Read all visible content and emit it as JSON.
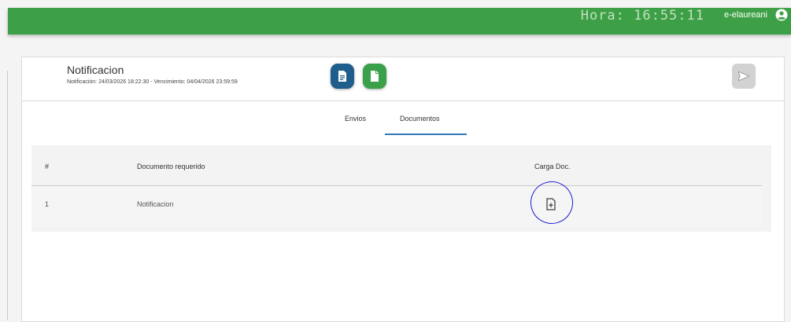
{
  "topbar": {
    "clock": "Hora: 16:55:11",
    "user": "e-elaureani",
    "user_icon": "user-circle-icon",
    "color": "#3ea046"
  },
  "header": {
    "title": "Notificacion",
    "subtitle": "Notificación: 24/03/2026 18:22:30 - Vencimiento: 04/04/2026 23:59:59",
    "doc_button_icon": "file-text-icon",
    "file_button_icon": "file-icon",
    "send_button_icon": "send-icon"
  },
  "tabs": [
    {
      "label": "Envios",
      "active": false
    },
    {
      "label": "Documentos",
      "active": true
    }
  ],
  "table": {
    "headers": [
      "#",
      "Documento requerido",
      "Carga Doc."
    ],
    "rows": [
      {
        "num": "1",
        "documento": "Notificacion",
        "carga_icon": "file-upload-icon"
      }
    ]
  },
  "colors": {
    "accent_blue": "#1f5d8c",
    "accent_green": "#3aa04a",
    "tab_underline": "#2f78b7",
    "annotation": "#1c1cd0"
  }
}
